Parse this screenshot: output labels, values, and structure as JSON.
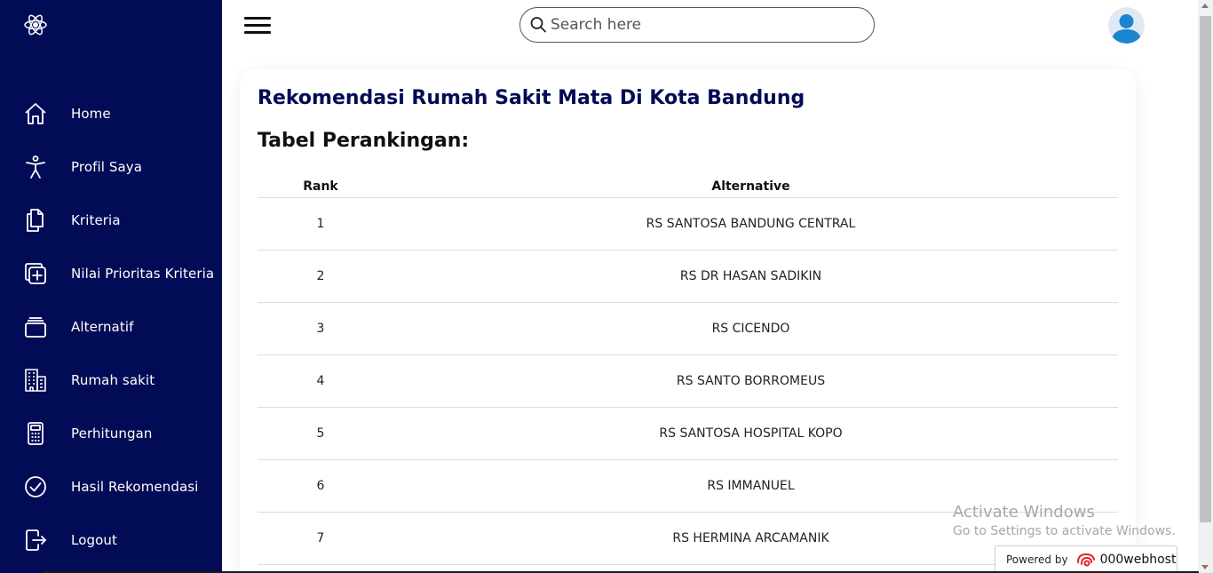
{
  "sidebar": {
    "items": [
      {
        "label": "Home",
        "icon": "home-icon"
      },
      {
        "label": "Profil Saya",
        "icon": "person-icon"
      },
      {
        "label": "Kriteria",
        "icon": "documents-icon"
      },
      {
        "label": "Nilai Prioritas Kriteria",
        "icon": "add-square-icon"
      },
      {
        "label": "Alternatif",
        "icon": "stack-icon"
      },
      {
        "label": "Rumah sakit",
        "icon": "building-icon"
      },
      {
        "label": "Perhitungan",
        "icon": "calculator-icon"
      },
      {
        "label": "Hasil Rekomendasi",
        "icon": "check-circle-icon"
      },
      {
        "label": "Logout",
        "icon": "logout-icon"
      }
    ]
  },
  "topbar": {
    "search_placeholder": "Search here"
  },
  "main": {
    "title": "Rekomendasi Rumah Sakit Mata Di Kota Bandung",
    "subtitle": "Tabel Perankingan:",
    "table": {
      "headers": [
        "Rank",
        "Alternative"
      ],
      "rows": [
        {
          "rank": "1",
          "alternative": "RS SANTOSA BANDUNG CENTRAL"
        },
        {
          "rank": "2",
          "alternative": "RS DR HASAN SADIKIN"
        },
        {
          "rank": "3",
          "alternative": "RS CICENDO"
        },
        {
          "rank": "4",
          "alternative": "RS SANTO BORROMEUS"
        },
        {
          "rank": "5",
          "alternative": "RS SANTOSA HOSPITAL KOPO"
        },
        {
          "rank": "6",
          "alternative": "RS IMMANUEL"
        },
        {
          "rank": "7",
          "alternative": "RS HERMINA ARCAMANIK"
        }
      ]
    }
  },
  "watermark": {
    "line1": "Activate Windows",
    "line2": "Go to Settings to activate Windows."
  },
  "powered": {
    "prefix": "Powered by",
    "brand": "000webhost"
  },
  "colors": {
    "sidebar_bg": "#020b55",
    "title": "#020b55"
  }
}
